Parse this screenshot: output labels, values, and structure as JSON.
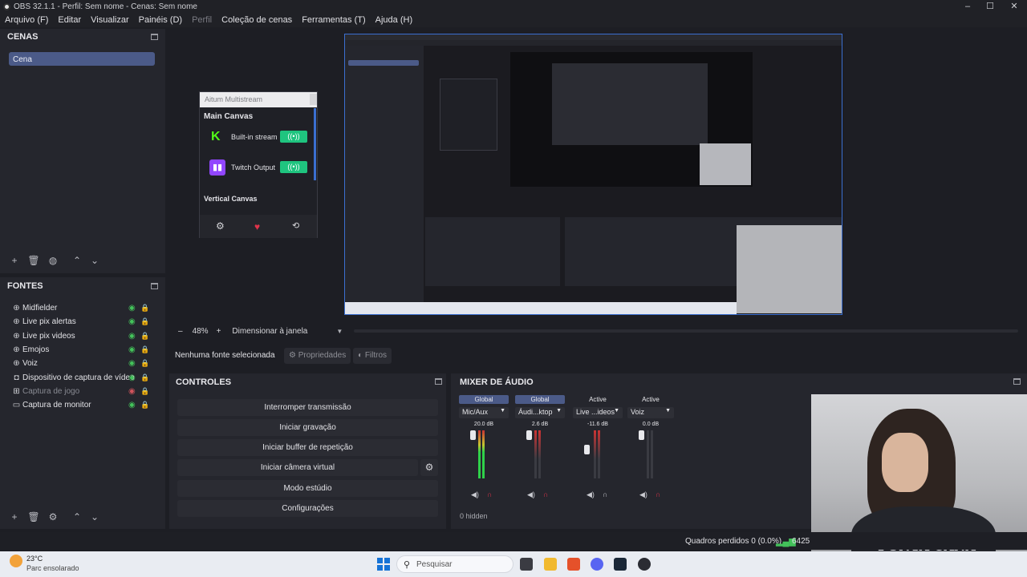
{
  "window": {
    "title": "OBS 32.1.1 - Perfil: Sem nome - Cenas: Sem nome"
  },
  "menu": {
    "items": [
      "Arquivo (F)",
      "Editar",
      "Visualizar",
      "Painéis (D)",
      "Perfil",
      "Coleção de cenas",
      "Ferramentas (T)",
      "Ajuda (H)"
    ]
  },
  "scenes": {
    "title": "CENAS",
    "items": [
      {
        "label": "Cena"
      }
    ]
  },
  "sources": {
    "title": "FONTES",
    "items": [
      {
        "label": "Midfielder",
        "icon": "globe-icon",
        "visible": true
      },
      {
        "label": "Live pix alertas",
        "icon": "globe-icon",
        "visible": true
      },
      {
        "label": "Live pix videos",
        "icon": "globe-icon",
        "visible": true
      },
      {
        "label": "Emojos",
        "icon": "globe-icon",
        "visible": true
      },
      {
        "label": "Voiz",
        "icon": "globe-icon",
        "visible": true
      },
      {
        "label": "Dispositivo de captura de vídeo",
        "icon": "camera-icon",
        "visible": true
      },
      {
        "label": "Captura de jogo",
        "icon": "gamepad-icon",
        "visible": false
      },
      {
        "label": "Captura de monitor",
        "icon": "monitor-icon",
        "visible": true
      }
    ]
  },
  "multistream": {
    "header": "Aitum Multistream",
    "main_canvas": "Main Canvas",
    "outputs": [
      {
        "label": "Built-in stream",
        "icon": "kick-icon",
        "color": "#53fc18"
      },
      {
        "label": "Twitch Output",
        "icon": "twitch-icon",
        "color": "#9146ff"
      }
    ],
    "vertical_canvas": "Vertical Canvas"
  },
  "zoom": {
    "value": "48%",
    "mode": "Dimensionar à janela"
  },
  "source_bar": {
    "no_source": "Nenhuma fonte selecionada",
    "properties": "Propriedades",
    "filters": "Filtros"
  },
  "controls": {
    "title": "CONTROLES",
    "buttons": [
      "Interromper transmissão",
      "Iniciar gravação",
      "Iniciar buffer de repetição",
      "Iniciar câmera virtual",
      "Modo estúdio",
      "Configurações"
    ]
  },
  "mixer": {
    "title": "MIXER DE ÁUDIO",
    "channels": [
      {
        "badge": "Global",
        "badge_active": true,
        "name": "Mic/Aux",
        "db": "20.0 dB"
      },
      {
        "badge": "Global",
        "badge_active": true,
        "name": "Áudi...ktop",
        "db": "2.6 dB"
      },
      {
        "badge": "Active",
        "badge_active": false,
        "name": "Live ...ideos",
        "db": "-11.6 dB"
      },
      {
        "badge": "Active",
        "badge_active": false,
        "name": "Voiz",
        "db": "0.0 dB"
      }
    ],
    "hidden": "0 hidden"
  },
  "status": {
    "frames": "Quadros perdidos 0 (0.0%)",
    "bitrate": "6425"
  },
  "taskbar": {
    "temp": "23°C",
    "weather": "Parc ensolarado",
    "search": "Pesquisar"
  },
  "colors": {
    "accent": "#4b5a88",
    "preview_border": "#3b6fd0",
    "ok_green": "#1fc47f"
  }
}
